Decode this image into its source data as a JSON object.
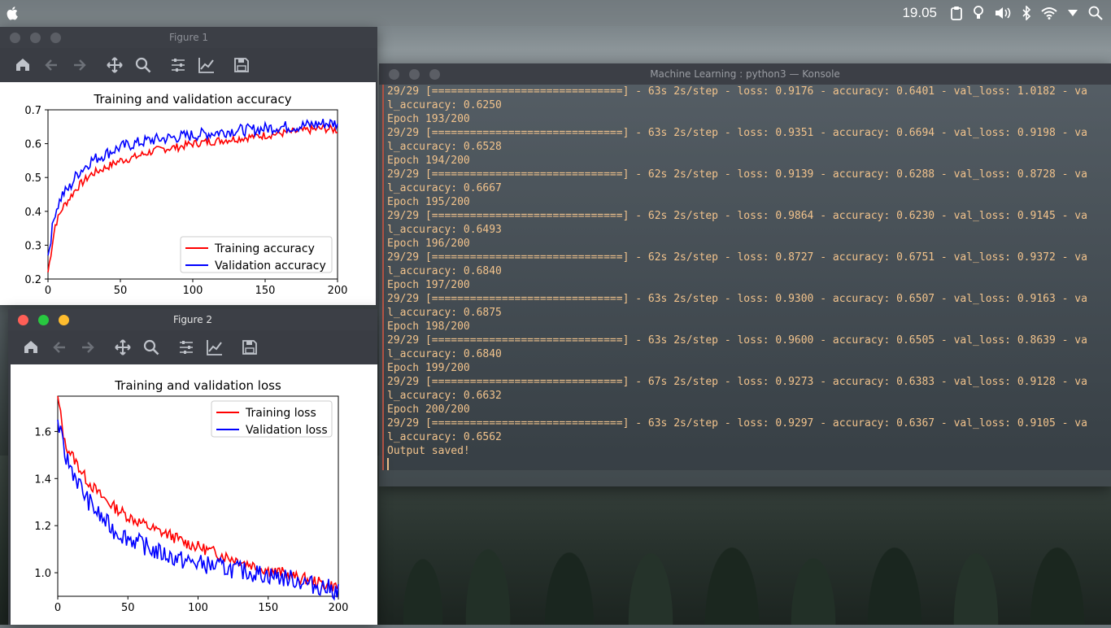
{
  "menubar": {
    "clock": "19.05",
    "icons": [
      "apple-icon",
      "clipboard-icon",
      "bulb-icon",
      "volume-icon",
      "bluetooth-icon",
      "wifi-icon",
      "dropdown-icon",
      "search-icon"
    ]
  },
  "figure1": {
    "title": "Figure 1",
    "toolbar": [
      "home-icon",
      "back-icon",
      "forward-icon",
      "pan-icon",
      "zoom-icon",
      "configure-icon",
      "edit-axes-icon",
      "save-icon"
    ],
    "chart_data": {
      "type": "line",
      "title": "Training and validation accuracy",
      "xlabel": "",
      "ylabel": "",
      "xlim": [
        0,
        200
      ],
      "ylim": [
        0.2,
        0.7
      ],
      "xticks": [
        "0",
        "50",
        "100",
        "150",
        "200"
      ],
      "yticks": [
        "0.2",
        "0.3",
        "0.4",
        "0.5",
        "0.6",
        "0.7"
      ],
      "legend": "lower-right",
      "series": [
        {
          "name": "Training accuracy",
          "color": "#ff0000",
          "points": [
            [
              0,
              0.22
            ],
            [
              5,
              0.36
            ],
            [
              10,
              0.41
            ],
            [
              15,
              0.44
            ],
            [
              20,
              0.47
            ],
            [
              30,
              0.51
            ],
            [
              40,
              0.53
            ],
            [
              50,
              0.55
            ],
            [
              60,
              0.56
            ],
            [
              70,
              0.575
            ],
            [
              80,
              0.585
            ],
            [
              90,
              0.59
            ],
            [
              100,
              0.6
            ],
            [
              110,
              0.605
            ],
            [
              120,
              0.61
            ],
            [
              130,
              0.615
            ],
            [
              140,
              0.62
            ],
            [
              150,
              0.625
            ],
            [
              160,
              0.63
            ],
            [
              170,
              0.635
            ],
            [
              180,
              0.64
            ],
            [
              190,
              0.645
            ],
            [
              200,
              0.64
            ]
          ]
        },
        {
          "name": "Validation accuracy",
          "color": "#0000ff",
          "points": [
            [
              0,
              0.27
            ],
            [
              5,
              0.4
            ],
            [
              10,
              0.45
            ],
            [
              15,
              0.47
            ],
            [
              20,
              0.51
            ],
            [
              30,
              0.55
            ],
            [
              40,
              0.57
            ],
            [
              50,
              0.59
            ],
            [
              60,
              0.6
            ],
            [
              70,
              0.61
            ],
            [
              80,
              0.615
            ],
            [
              90,
              0.62
            ],
            [
              100,
              0.625
            ],
            [
              110,
              0.63
            ],
            [
              120,
              0.635
            ],
            [
              130,
              0.64
            ],
            [
              140,
              0.64
            ],
            [
              150,
              0.645
            ],
            [
              160,
              0.65
            ],
            [
              170,
              0.65
            ],
            [
              180,
              0.655
            ],
            [
              190,
              0.66
            ],
            [
              200,
              0.66
            ]
          ]
        }
      ]
    }
  },
  "figure2": {
    "title": "Figure 2",
    "toolbar": [
      "home-icon",
      "back-icon",
      "forward-icon",
      "pan-icon",
      "zoom-icon",
      "configure-icon",
      "edit-axes-icon",
      "save-icon"
    ],
    "chart_data": {
      "type": "line",
      "title": "Training and validation loss",
      "xlabel": "",
      "ylabel": "",
      "xlim": [
        0,
        200
      ],
      "ylim": [
        0.9,
        1.75
      ],
      "xticks": [
        "0",
        "50",
        "100",
        "150",
        "200"
      ],
      "yticks": [
        "1.0",
        "1.2",
        "1.4",
        "1.6"
      ],
      "legend": "upper-right",
      "series": [
        {
          "name": "Training loss",
          "color": "#ff0000",
          "points": [
            [
              0,
              1.75
            ],
            [
              5,
              1.55
            ],
            [
              10,
              1.5
            ],
            [
              15,
              1.45
            ],
            [
              20,
              1.4
            ],
            [
              30,
              1.33
            ],
            [
              40,
              1.28
            ],
            [
              50,
              1.24
            ],
            [
              60,
              1.21
            ],
            [
              70,
              1.18
            ],
            [
              80,
              1.16
            ],
            [
              90,
              1.13
            ],
            [
              100,
              1.11
            ],
            [
              110,
              1.09
            ],
            [
              120,
              1.07
            ],
            [
              130,
              1.05
            ],
            [
              140,
              1.03
            ],
            [
              150,
              1.01
            ],
            [
              160,
              1.0
            ],
            [
              170,
              0.98
            ],
            [
              180,
              0.97
            ],
            [
              190,
              0.95
            ],
            [
              200,
              0.94
            ]
          ]
        },
        {
          "name": "Validation loss",
          "color": "#0000ff",
          "points": [
            [
              0,
              1.65
            ],
            [
              5,
              1.5
            ],
            [
              10,
              1.44
            ],
            [
              15,
              1.38
            ],
            [
              20,
              1.32
            ],
            [
              30,
              1.24
            ],
            [
              40,
              1.18
            ],
            [
              50,
              1.15
            ],
            [
              60,
              1.12
            ],
            [
              70,
              1.09
            ],
            [
              80,
              1.07
            ],
            [
              90,
              1.05
            ],
            [
              100,
              1.04
            ],
            [
              110,
              1.03
            ],
            [
              120,
              1.02
            ],
            [
              130,
              1.01
            ],
            [
              140,
              1.0
            ],
            [
              150,
              0.99
            ],
            [
              160,
              0.98
            ],
            [
              170,
              0.97
            ],
            [
              180,
              0.95
            ],
            [
              190,
              0.94
            ],
            [
              200,
              0.92
            ]
          ]
        }
      ]
    }
  },
  "konsole": {
    "title": "Machine Learning : python3 — Konsole",
    "lines": [
      "29/29 [==============================] - 63s 2s/step - loss: 0.9176 - accuracy: 0.6401 - val_loss: 1.0182 - va",
      "l_accuracy: 0.6250",
      "Epoch 193/200",
      "29/29 [==============================] - 63s 2s/step - loss: 0.9351 - accuracy: 0.6694 - val_loss: 0.9198 - va",
      "l_accuracy: 0.6528",
      "Epoch 194/200",
      "29/29 [==============================] - 62s 2s/step - loss: 0.9139 - accuracy: 0.6288 - val_loss: 0.8728 - va",
      "l_accuracy: 0.6667",
      "Epoch 195/200",
      "29/29 [==============================] - 62s 2s/step - loss: 0.9864 - accuracy: 0.6230 - val_loss: 0.9145 - va",
      "l_accuracy: 0.6493",
      "Epoch 196/200",
      "29/29 [==============================] - 62s 2s/step - loss: 0.8727 - accuracy: 0.6751 - val_loss: 0.9372 - va",
      "l_accuracy: 0.6840",
      "Epoch 197/200",
      "29/29 [==============================] - 63s 2s/step - loss: 0.9300 - accuracy: 0.6507 - val_loss: 0.9163 - va",
      "l_accuracy: 0.6875",
      "Epoch 198/200",
      "29/29 [==============================] - 63s 2s/step - loss: 0.9600 - accuracy: 0.6505 - val_loss: 0.8639 - va",
      "l_accuracy: 0.6840",
      "Epoch 199/200",
      "29/29 [==============================] - 67s 2s/step - loss: 0.9273 - accuracy: 0.6383 - val_loss: 0.9128 - va",
      "l_accuracy: 0.6632",
      "Epoch 200/200",
      "29/29 [==============================] - 63s 2s/step - loss: 0.9297 - accuracy: 0.6367 - val_loss: 0.9105 - va",
      "l_accuracy: 0.6562",
      "Output saved!"
    ]
  }
}
